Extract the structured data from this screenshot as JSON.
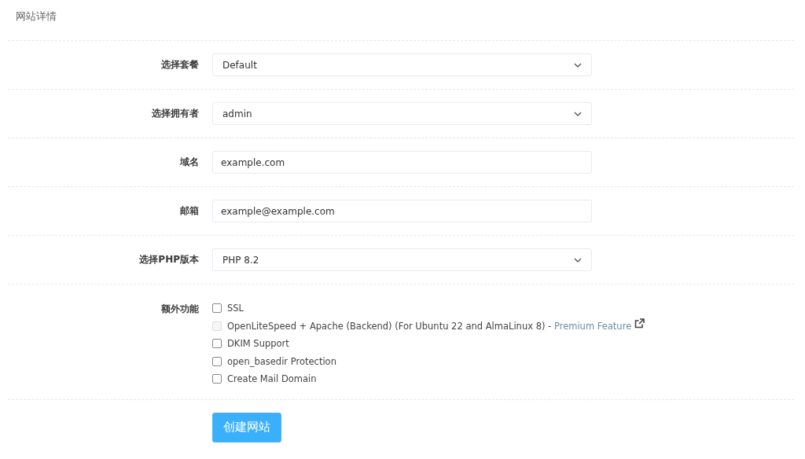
{
  "title": "网站详情",
  "fields": [
    {
      "label": "选择套餐",
      "kind": "select",
      "value": "Default"
    },
    {
      "label": "选择拥有者",
      "kind": "select",
      "value": "admin"
    },
    {
      "label": "域名",
      "kind": "input",
      "value": "example.com"
    },
    {
      "label": "邮箱",
      "kind": "input",
      "value": "example@example.com"
    },
    {
      "label": "选择PHP版本",
      "kind": "select",
      "value": "PHP 8.2"
    }
  ],
  "features": {
    "label": "额外功能",
    "options": [
      {
        "label": "SSL",
        "checked": false,
        "disabled": false
      },
      {
        "label": "OpenLiteSpeed + Apache (Backend) (For Ubuntu 22 and AlmaLinux 8) - ",
        "link": "Premium Feature",
        "checked": false,
        "disabled": true
      },
      {
        "label": "DKIM Support",
        "checked": false,
        "disabled": false
      },
      {
        "label": "open_basedir Protection",
        "checked": false,
        "disabled": false
      },
      {
        "label": "Create Mail Domain",
        "checked": false,
        "disabled": false
      }
    ]
  },
  "submit": "创建网站"
}
